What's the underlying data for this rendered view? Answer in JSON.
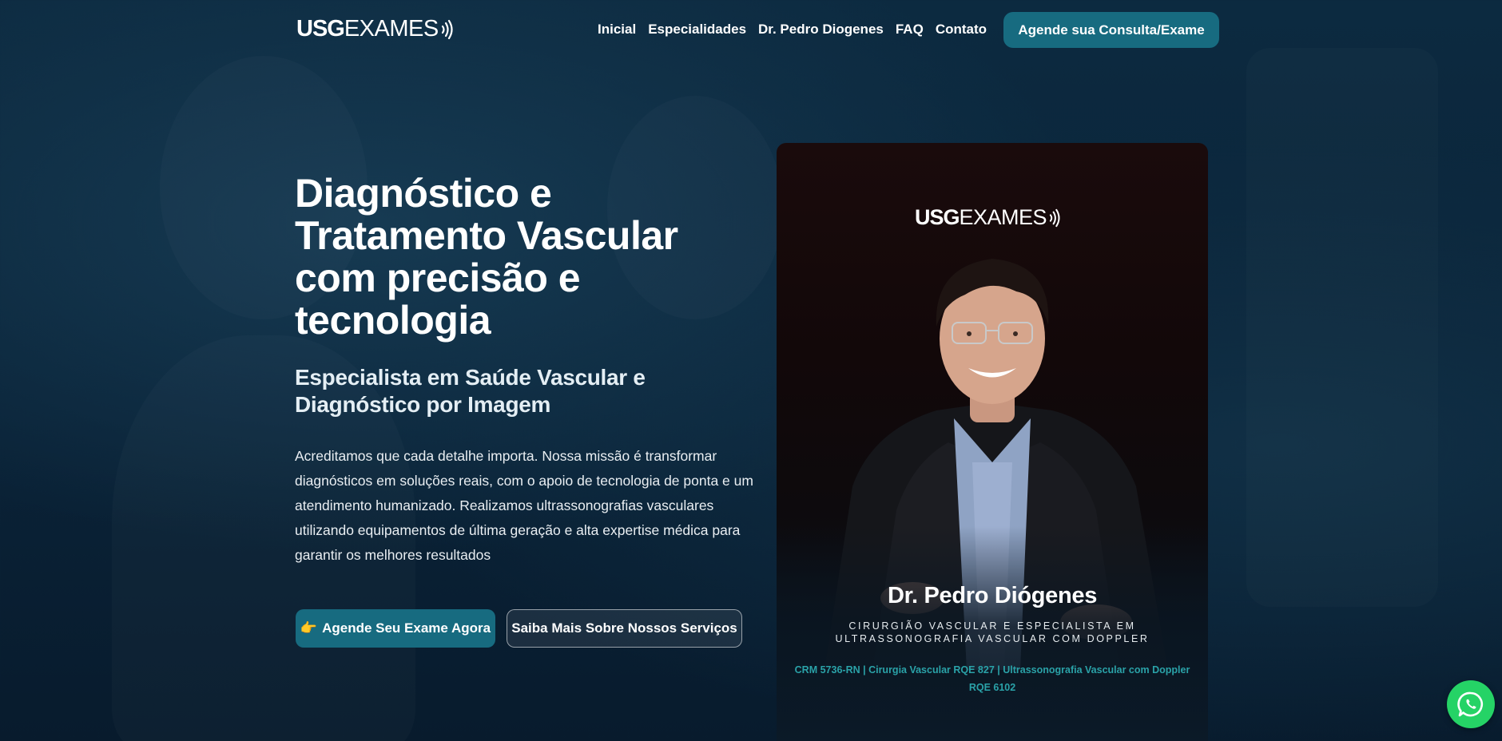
{
  "brand": {
    "logo_bold": "USG",
    "logo_light": "EXAMES"
  },
  "nav": {
    "items": [
      "Inicial",
      "Especialidades",
      "Dr. Pedro Diogenes",
      "FAQ",
      "Contato"
    ]
  },
  "header": {
    "cta_label": "Agende sua Consulta/Exame"
  },
  "hero": {
    "title": "Diagnóstico e Tratamento Vascular com precisão e tecnologia",
    "subtitle": "Especialista em Saúde Vascular e Diagnóstico por Imagem",
    "description": "Acreditamos que cada detalhe importa. Nossa missão é transformar diagnósticos em soluções reais, com o apoio de tecnologia de ponta e um atendimento humanizado. Realizamos ultrassonografias vasculares utilizando equipamentos de última geração e alta expertise médica para garantir os melhores resultados",
    "primary_button_icon": "👉",
    "primary_button_label": "Agende Seu Exame Agora",
    "secondary_button_label": "Saiba Mais Sobre Nossos Serviços"
  },
  "doctor_card": {
    "name": "Dr. Pedro Diógenes",
    "role_line1": "CIRURGIÃO VASCULAR E ESPECIALISTA EM",
    "role_line2": "ULTRASSONOGRAFIA VASCULAR COM DOPPLER",
    "credentials_line1": "CRM 5736-RN | Cirurgia Vascular RQE 827 | Ultrassonografia Vascular com Doppler",
    "credentials_line2": "RQE 6102"
  },
  "colors": {
    "accent": "#176b80",
    "credentials": "#2aa2a8",
    "whatsapp": "#25d366",
    "background": "#0a2338"
  },
  "icons": {
    "logo_mark": "sound-waves-icon",
    "floating": "whatsapp-icon"
  }
}
